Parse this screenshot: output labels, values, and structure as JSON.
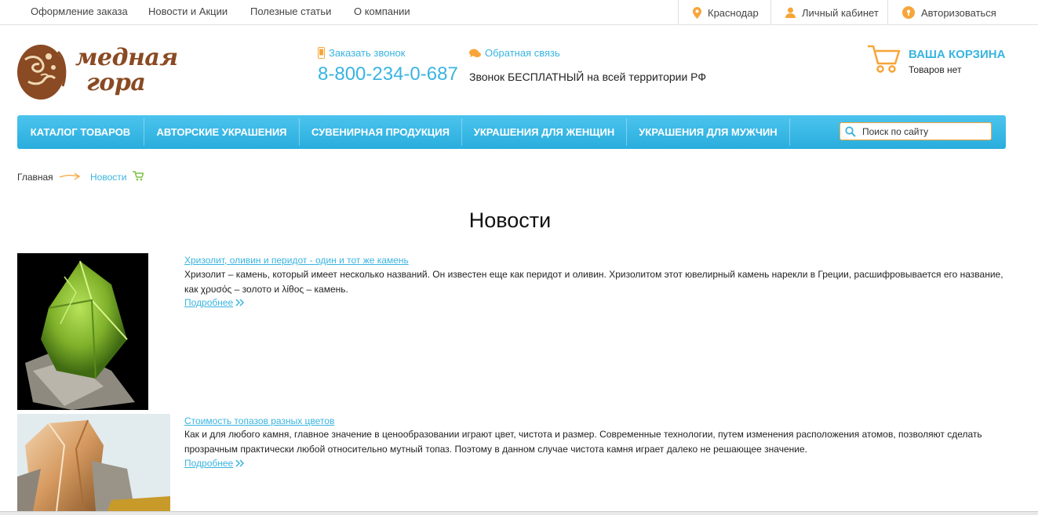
{
  "topnav": {
    "items": [
      "Оформление заказа",
      "Новости и Акции",
      "Полезные статьи",
      "О компании"
    ],
    "city": "Краснодар",
    "account": "Личный кабинет",
    "login": "Авторизоваться"
  },
  "header": {
    "logo_line1": "медная",
    "logo_line2": "гора",
    "callback": "Заказать звонок",
    "feedback": "Обратная связь",
    "phone": "8-800-234-0-687",
    "free_call": "Звонок БЕСПЛАТНЫЙ на всей территории РФ",
    "cart_title": "ВАША КОРЗИНА",
    "cart_status": "Товаров нет"
  },
  "nav": {
    "items": [
      "КАТАЛОГ ТОВАРОВ",
      "АВТОРСКИЕ УКРАШЕНИЯ",
      "СУВЕНИРНАЯ ПРОДУКЦИЯ",
      "УКРАШЕНИЯ ДЛЯ ЖЕНЩИН",
      "УКРАШЕНИЯ ДЛЯ МУЖЧИН"
    ],
    "search_placeholder": "Поиск по сайту"
  },
  "breadcrumb": {
    "home": "Главная",
    "current": "Новости"
  },
  "page_title": "Новости",
  "articles": [
    {
      "title": "Хризолит, оливин и перидот - один и тот же камень",
      "text": "Хризолит – камень, который имеет несколько названий. Он известен еще как перидот и оливин. Хризолитом этот ювелирный камень нарекли в Греции, расшифровывается его название, как χρυσός – золото и λίθος – камень.",
      "more": "Подробнее"
    },
    {
      "title": "Стоимость топазов разных цветов",
      "text": "Как и для любого камня, главное значение в ценообразовании играют цвет, чистота и размер. Современные технологии, путем изменения расположения атомов, позволяют сделать прозрачным практически любой относительно мутный топаз. Поэтому в данном случае чистота камня играет далеко не решающее значение.",
      "more": "Подробнее"
    }
  ],
  "colors": {
    "accent": "#39b4e0",
    "orange": "#f7a539",
    "brand_brown": "#8a4a23"
  }
}
